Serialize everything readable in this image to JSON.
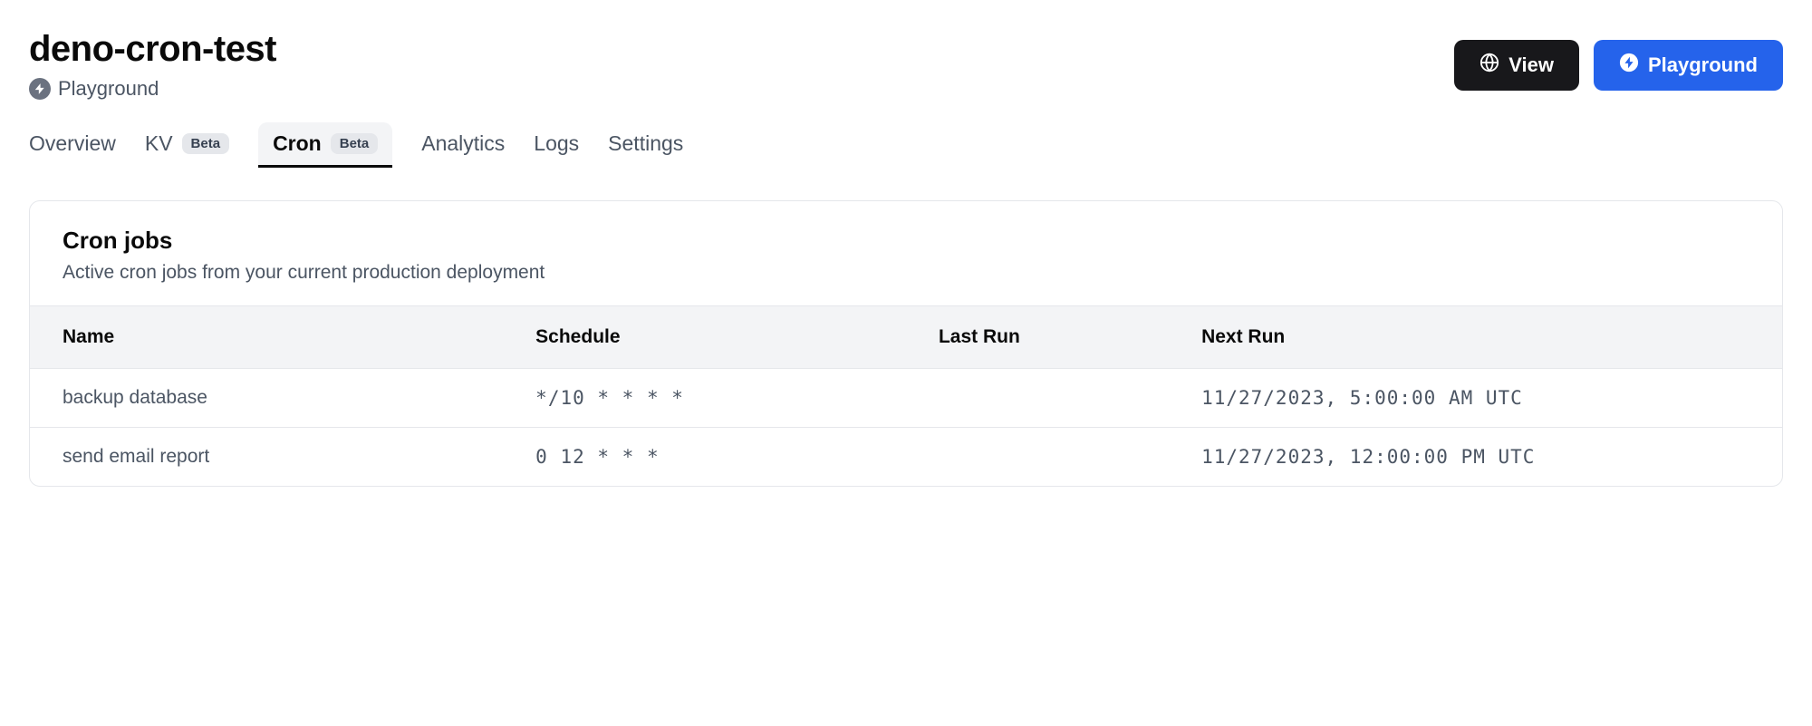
{
  "project": {
    "title": "deno-cron-test",
    "type": "Playground"
  },
  "buttons": {
    "view": "View",
    "playground": "Playground"
  },
  "tabs": [
    {
      "label": "Overview",
      "badge": null,
      "active": false
    },
    {
      "label": "KV",
      "badge": "Beta",
      "active": false
    },
    {
      "label": "Cron",
      "badge": "Beta",
      "active": true
    },
    {
      "label": "Analytics",
      "badge": null,
      "active": false
    },
    {
      "label": "Logs",
      "badge": null,
      "active": false
    },
    {
      "label": "Settings",
      "badge": null,
      "active": false
    }
  ],
  "card": {
    "title": "Cron jobs",
    "subtitle": "Active cron jobs from your current production deployment"
  },
  "table": {
    "headers": {
      "name": "Name",
      "schedule": "Schedule",
      "last_run": "Last Run",
      "next_run": "Next Run"
    },
    "rows": [
      {
        "name": "backup database",
        "schedule": "*/10 * * * *",
        "last_run": "",
        "next_run": "11/27/2023, 5:00:00 AM UTC"
      },
      {
        "name": "send email report",
        "schedule": "0 12 * * *",
        "last_run": "",
        "next_run": "11/27/2023, 12:00:00 PM UTC"
      }
    ]
  }
}
